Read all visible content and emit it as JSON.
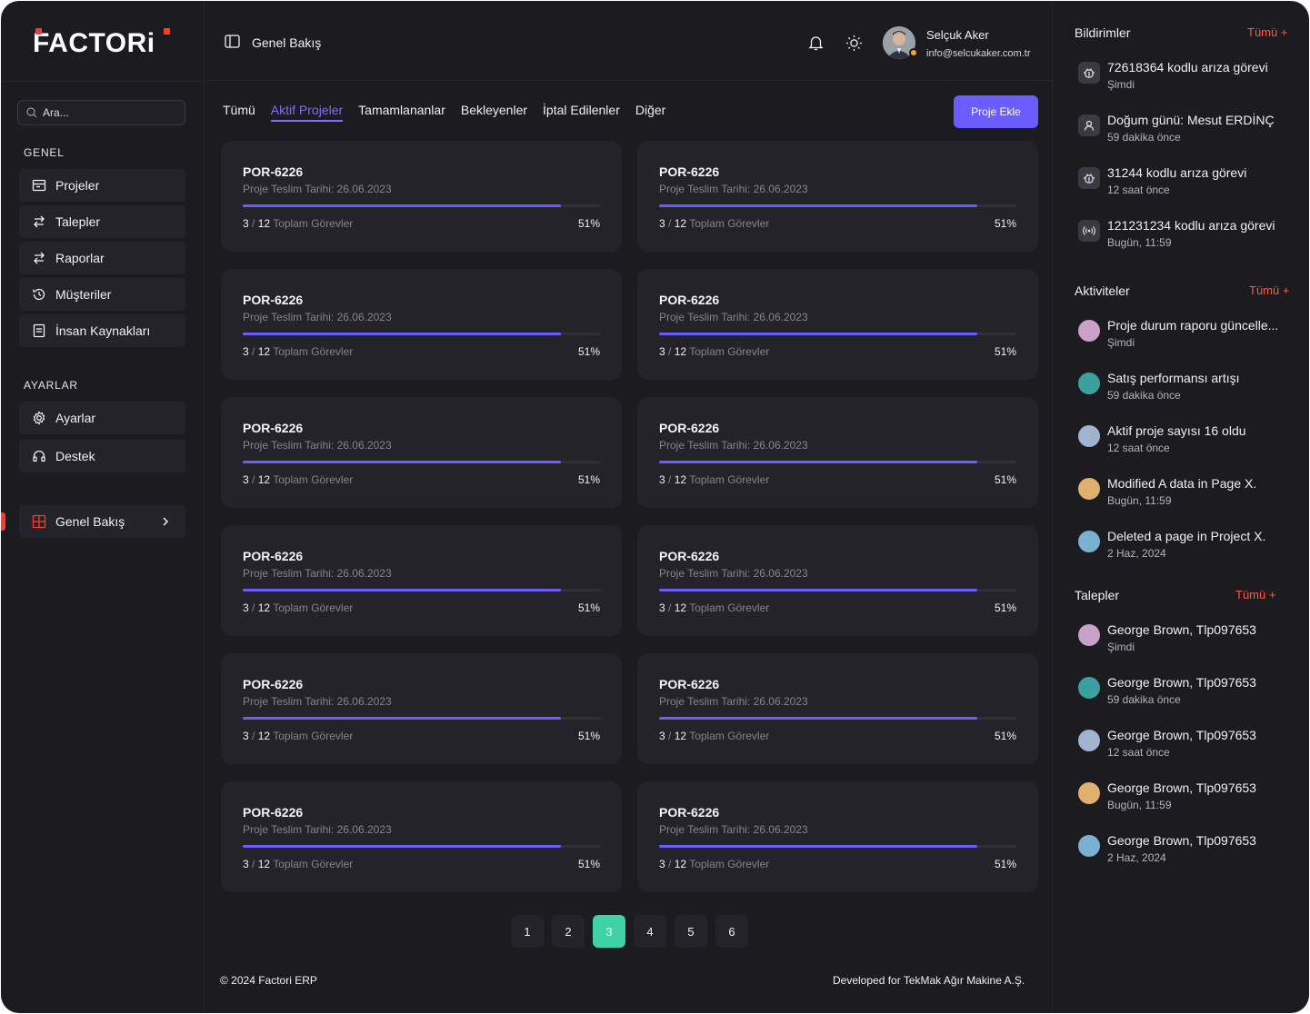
{
  "brand": {
    "name": "FACTORi",
    "accent": "#ff3b30"
  },
  "sidebar": {
    "search_placeholder": "Ara...",
    "sections": [
      {
        "title": "GENEL",
        "items": [
          {
            "label": "Projeler",
            "icon": "folder-icon"
          },
          {
            "label": "Talepler",
            "icon": "swap-icon"
          },
          {
            "label": "Raporlar",
            "icon": "swap-icon"
          },
          {
            "label": "Müşteriler",
            "icon": "history-icon"
          },
          {
            "label": "İnsan Kaynakları",
            "icon": "document-icon"
          }
        ]
      },
      {
        "title": "AYARLAR",
        "items": [
          {
            "label": "Ayarlar",
            "icon": "gear-icon"
          },
          {
            "label": "Destek",
            "icon": "headset-icon"
          }
        ]
      }
    ],
    "active_item": {
      "label": "Genel Bakış",
      "icon": "grid-icon"
    }
  },
  "header": {
    "breadcrumb": "Genel Bakış",
    "user": {
      "name": "Selçuk Aker",
      "email": "info@selcukaker.com.tr"
    }
  },
  "tabs": [
    {
      "label": "Tümü",
      "active": false
    },
    {
      "label": "Aktif Projeler",
      "active": true
    },
    {
      "label": "Tamamlananlar",
      "active": false
    },
    {
      "label": "Bekleyenler",
      "active": false
    },
    {
      "label": "İptal Edilenler",
      "active": false
    },
    {
      "label": "Diğer",
      "active": false
    }
  ],
  "add_project_label": "Proje Ekle",
  "projects": [
    {
      "code": "POR-6226",
      "date": "Proje Teslim Tarihi: 26.06.2023",
      "done": "3",
      "sep": "/",
      "total": "12",
      "total_label": "Toplam Görevler",
      "percent": "51%",
      "progress": 0.89
    },
    {
      "code": "POR-6226",
      "date": "Proje Teslim Tarihi: 26.06.2023",
      "done": "3",
      "sep": "/",
      "total": "12",
      "total_label": "Toplam Görevler",
      "percent": "51%",
      "progress": 0.89
    },
    {
      "code": "POR-6226",
      "date": "Proje Teslim Tarihi: 26.06.2023",
      "done": "3",
      "sep": "/",
      "total": "12",
      "total_label": "Toplam Görevler",
      "percent": "51%",
      "progress": 0.89
    },
    {
      "code": "POR-6226",
      "date": "Proje Teslim Tarihi: 26.06.2023",
      "done": "3",
      "sep": "/",
      "total": "12",
      "total_label": "Toplam Görevler",
      "percent": "51%",
      "progress": 0.89
    },
    {
      "code": "POR-6226",
      "date": "Proje Teslim Tarihi: 26.06.2023",
      "done": "3",
      "sep": "/",
      "total": "12",
      "total_label": "Toplam Görevler",
      "percent": "51%",
      "progress": 0.89
    },
    {
      "code": "POR-6226",
      "date": "Proje Teslim Tarihi: 26.06.2023",
      "done": "3",
      "sep": "/",
      "total": "12",
      "total_label": "Toplam Görevler",
      "percent": "51%",
      "progress": 0.89
    },
    {
      "code": "POR-6226",
      "date": "Proje Teslim Tarihi: 26.06.2023",
      "done": "3",
      "sep": "/",
      "total": "12",
      "total_label": "Toplam Görevler",
      "percent": "51%",
      "progress": 0.89
    },
    {
      "code": "POR-6226",
      "date": "Proje Teslim Tarihi: 26.06.2023",
      "done": "3",
      "sep": "/",
      "total": "12",
      "total_label": "Toplam Görevler",
      "percent": "51%",
      "progress": 0.89
    },
    {
      "code": "POR-6226",
      "date": "Proje Teslim Tarihi: 26.06.2023",
      "done": "3",
      "sep": "/",
      "total": "12",
      "total_label": "Toplam Görevler",
      "percent": "51%",
      "progress": 0.89
    },
    {
      "code": "POR-6226",
      "date": "Proje Teslim Tarihi: 26.06.2023",
      "done": "3",
      "sep": "/",
      "total": "12",
      "total_label": "Toplam Görevler",
      "percent": "51%",
      "progress": 0.89
    },
    {
      "code": "POR-6226",
      "date": "Proje Teslim Tarihi: 26.06.2023",
      "done": "3",
      "sep": "/",
      "total": "12",
      "total_label": "Toplam Görevler",
      "percent": "51%",
      "progress": 0.89
    },
    {
      "code": "POR-6226",
      "date": "Proje Teslim Tarihi: 26.06.2023",
      "done": "3",
      "sep": "/",
      "total": "12",
      "total_label": "Toplam Görevler",
      "percent": "51%",
      "progress": 0.89
    }
  ],
  "pagination": {
    "pages": [
      "1",
      "2",
      "3",
      "4",
      "5",
      "6"
    ],
    "current": "3",
    "active_color": "#3ed2a6"
  },
  "footer": {
    "left": "© 2024 Factori ERP",
    "right": "Developed for TekMak Ağır Makine A.Ş."
  },
  "right_panel": {
    "notifications": {
      "title": "Bildirimler",
      "all_label": "Tümü +",
      "items": [
        {
          "text": "72618364 kodlu arıza görevi",
          "time": "Şimdi",
          "icon": "bug-icon"
        },
        {
          "text": "Doğum günü: Mesut ERDİNÇ",
          "time": "59 dakika önce",
          "icon": "user-icon"
        },
        {
          "text": "31244 kodlu arıza görevi",
          "time": "12 saat önce",
          "icon": "bug-icon"
        },
        {
          "text": "121231234 kodlu arıza görevi",
          "time": "Bugün, 11:59",
          "icon": "broadcast-icon"
        }
      ]
    },
    "activities": {
      "title": "Aktiviteler",
      "all_label": "Tümü +",
      "items": [
        {
          "text": "Proje durum raporu güncelle...",
          "time": "Şimdi",
          "avatar": "#c8a0c8"
        },
        {
          "text": "Satış performansı artışı",
          "time": "59 dakika önce",
          "avatar": "#3aa0a0"
        },
        {
          "text": "Aktif proje sayısı 16 oldu",
          "time": "12 saat önce",
          "avatar": "#a0b4d0"
        },
        {
          "text": "Modified A data in Page X.",
          "time": "Bugün, 11:59",
          "avatar": "#e0b070"
        },
        {
          "text": "Deleted a page in Project X.",
          "time": "2 Haz, 2024",
          "avatar": "#7ab0d0"
        }
      ]
    },
    "requests": {
      "title": "Talepler",
      "all_label": "Tümü +",
      "items": [
        {
          "text": "George Brown, Tlp097653",
          "time": "Şimdi",
          "avatar": "#c8a0c8"
        },
        {
          "text": "George Brown, Tlp097653",
          "time": "59 dakika önce",
          "avatar": "#3aa0a0"
        },
        {
          "text": "George Brown, Tlp097653",
          "time": "12 saat önce",
          "avatar": "#a0b4d0"
        },
        {
          "text": "George Brown, Tlp097653",
          "time": "Bugün, 11:59",
          "avatar": "#e0b070"
        },
        {
          "text": "George Brown, Tlp097653",
          "time": "2 Haz, 2024",
          "avatar": "#7ab0d0"
        }
      ]
    }
  }
}
